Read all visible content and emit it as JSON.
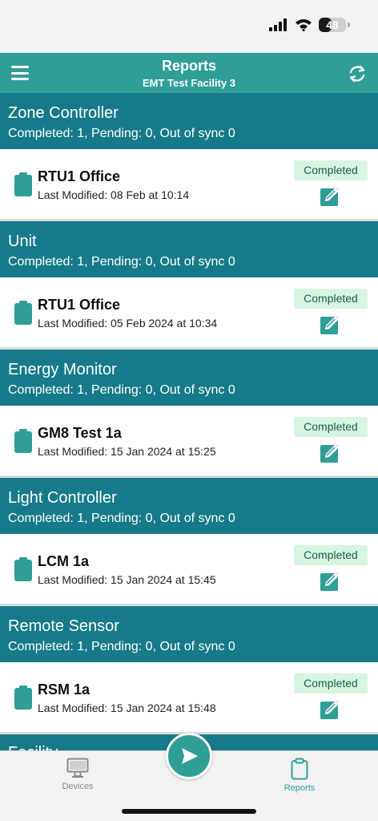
{
  "status_bar": {
    "battery": "48",
    "battery_level": 0.48
  },
  "header": {
    "title": "Reports",
    "subtitle": "EMT Test Facility 3"
  },
  "sections": [
    {
      "title": "Zone Controller",
      "summary": "Completed: 1, Pending: 0, Out of sync 0",
      "item": {
        "name": "RTU1 Office",
        "modified": "Last Modified: 08 Feb at 10:14",
        "status": "Completed"
      }
    },
    {
      "title": "Unit",
      "summary": "Completed: 1, Pending: 0, Out of sync 0",
      "item": {
        "name": "RTU1 Office",
        "modified": "Last Modified: 05 Feb 2024 at 10:34",
        "status": "Completed"
      }
    },
    {
      "title": "Energy Monitor",
      "summary": "Completed: 1, Pending: 0, Out of sync 0",
      "item": {
        "name": "GM8 Test 1a",
        "modified": "Last Modified: 15 Jan 2024 at 15:25",
        "status": "Completed"
      }
    },
    {
      "title": "Light Controller",
      "summary": "Completed: 1, Pending: 0, Out of sync 0",
      "item": {
        "name": "LCM 1a",
        "modified": "Last Modified: 15 Jan 2024 at 15:45",
        "status": "Completed"
      }
    },
    {
      "title": "Remote Sensor",
      "summary": "Completed: 1, Pending: 0, Out of sync 0",
      "item": {
        "name": "RSM 1a",
        "modified": "Last Modified: 15 Jan 2024 at 15:48",
        "status": "Completed"
      }
    }
  ],
  "partial_section": {
    "title": "Facility"
  },
  "tabbar": {
    "devices_label": "Devices",
    "reports_label": "Reports",
    "active_tab": "Reports"
  },
  "icons": {
    "menu": "hamburger-icon",
    "refresh": "refresh-icon",
    "item": "clipboard-icon",
    "edit": "edit-icon",
    "devices": "monitor-icon",
    "reports": "clipboard-outline-icon",
    "send": "send-icon"
  },
  "colors": {
    "header": "#2f9e97",
    "section": "#167a8a",
    "badge_bg": "#d7f5e3",
    "badge_text": "#1f5f3f",
    "accent": "#2f9e97"
  }
}
